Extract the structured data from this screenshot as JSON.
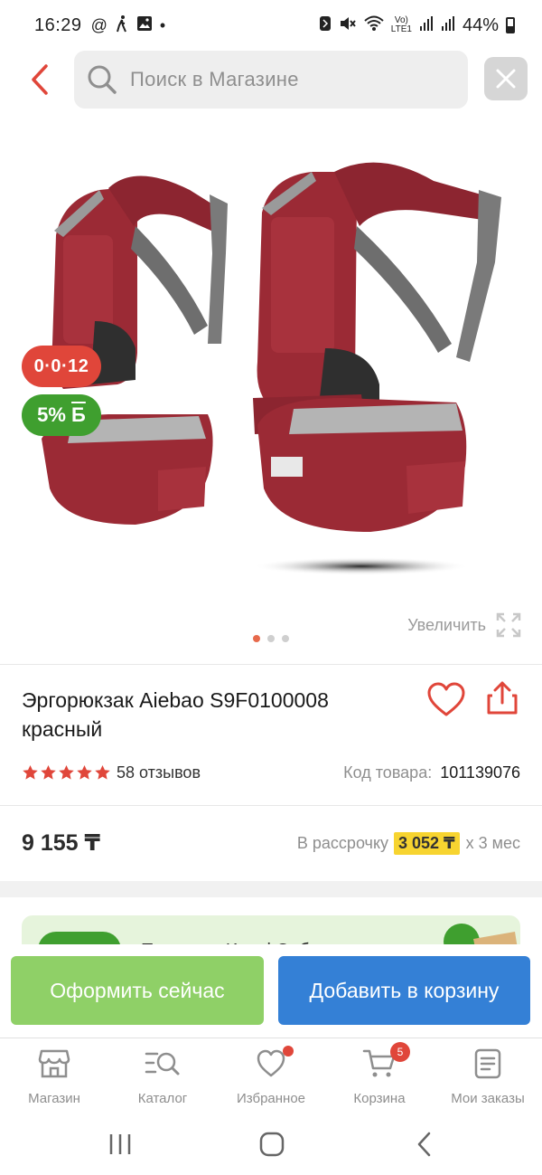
{
  "status_bar": {
    "time": "16:29",
    "left_icons": [
      "at-icon",
      "walk-icon",
      "image-icon",
      "dot-icon"
    ],
    "right_icons": [
      "nfc-icon",
      "mute-icon",
      "wifi-icon",
      "volte-icon",
      "signal-icon",
      "signal-icon"
    ],
    "battery_percent": "44%"
  },
  "header": {
    "search_placeholder": "Поиск в Магазине"
  },
  "product": {
    "timer_badge": "0·0·12",
    "bonus_badge": "5%",
    "bonus_symbol": "Б",
    "zoom_label": "Увеличить",
    "gallery_page": 1,
    "gallery_total": 3,
    "title_line1": "Эргорюкзак Aiebao S9F0100008",
    "title_line2": "красный",
    "rating": 5,
    "reviews": "58 отзывов",
    "code_label": "Код товара:",
    "code_value": "101139076",
    "price": "9 155 ₸",
    "installment_prefix": "В рассрочку",
    "installment_amount": "3 052 ₸",
    "installment_suffix": "х 3 мес",
    "image_color": "#9b2a35"
  },
  "promo": {
    "text": "Получите Kaspi Сибо..."
  },
  "actions": {
    "checkout_label": "Оформить сейчас",
    "add_to_cart_label": "Добавить в корзину",
    "checkout_color": "#8fd067",
    "cart_color": "#3480d6"
  },
  "bottom_nav": {
    "items": [
      {
        "label": "Магазин",
        "icon": "store-icon"
      },
      {
        "label": "Каталог",
        "icon": "catalog-icon"
      },
      {
        "label": "Избранное",
        "icon": "heart-icon"
      },
      {
        "label": "Корзина",
        "icon": "cart-icon",
        "badge": "5"
      },
      {
        "label": "Мои заказы",
        "icon": "orders-icon"
      }
    ]
  },
  "colors": {
    "accent_red": "#e0463a",
    "bonus_green": "#3f9f2f",
    "installment_yellow": "#f7d430"
  }
}
